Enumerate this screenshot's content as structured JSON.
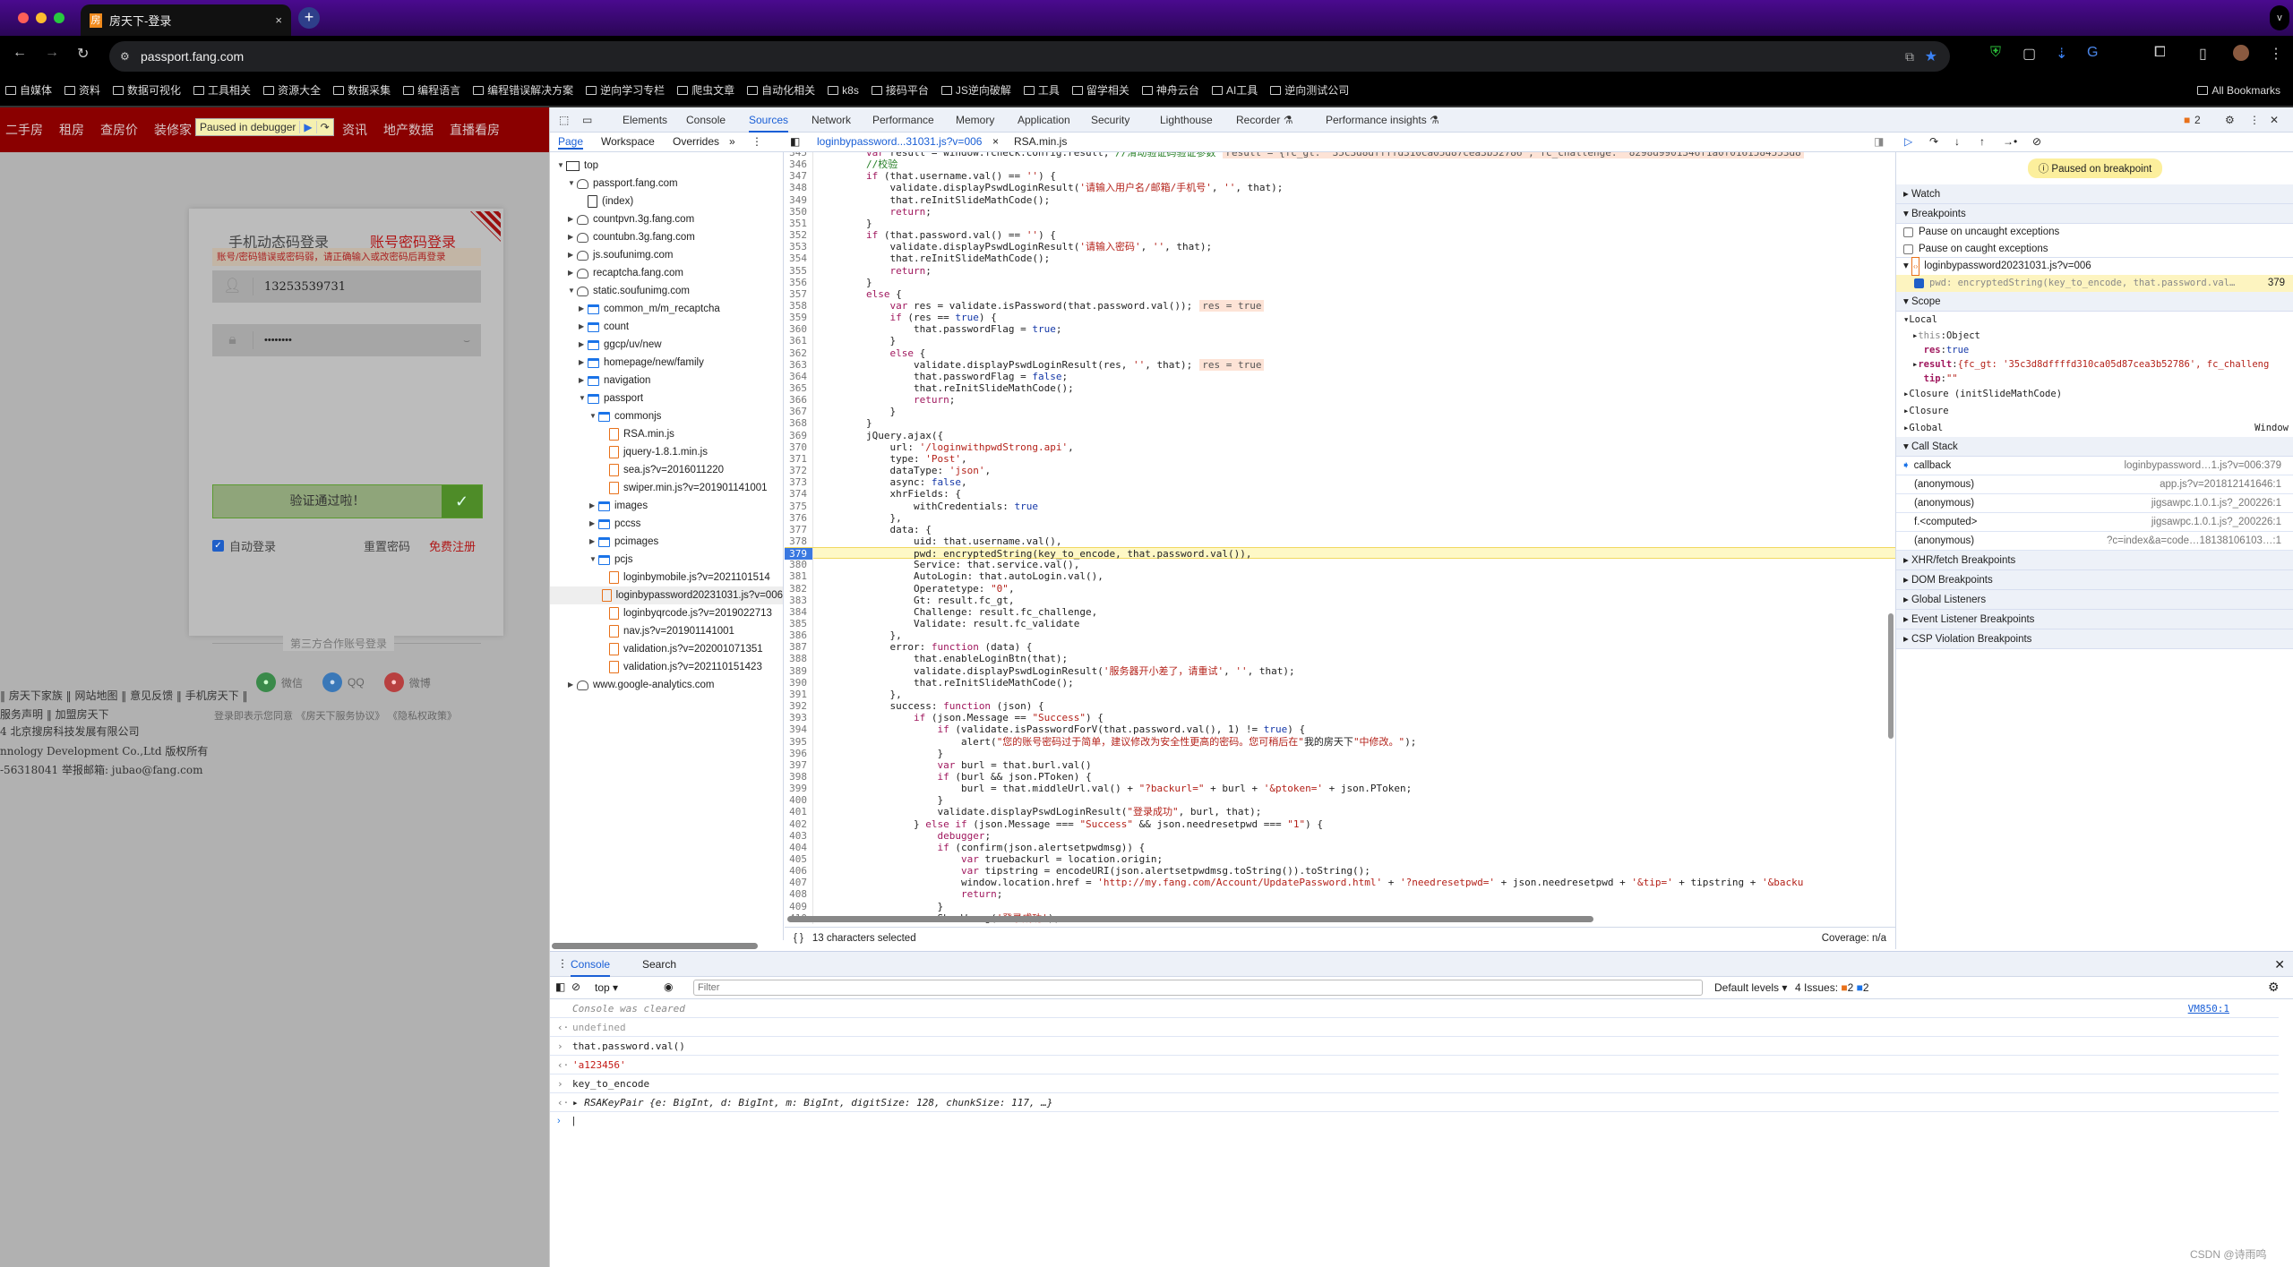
{
  "browser": {
    "tab_title": "房天下-登录",
    "tab_favicon": "房",
    "url": "passport.fang.com",
    "bookmarks": [
      "自媒体",
      "资料",
      "数据可视化",
      "工具相关",
      "资源大全",
      "数据采集",
      "编程语言",
      "编程错误解决方案",
      "逆向学习专栏",
      "爬虫文章",
      "自动化相关",
      "k8s",
      "接码平台",
      "JS逆向破解",
      "工具",
      "留学相关",
      "神舟云台",
      "AI工具",
      "逆向测试公司"
    ],
    "all_bookmarks": "All Bookmarks"
  },
  "page": {
    "nav": [
      "二手房",
      "租房",
      "查房价",
      "装修家",
      "资讯",
      "地产数据",
      "直播看房"
    ],
    "paused_overlay": "Paused in debugger",
    "login": {
      "tab_mobile": "手机动态码登录",
      "tab_password": "账号密码登录",
      "error": "账号/密码错误或密码弱，请正确输入或改密码后再登录",
      "username": "13253539731",
      "password_mask": "••••••••",
      "slider_text": "验证通过啦！",
      "auto_login": "自动登录",
      "reset_password": "重置密码",
      "register": "免费注册",
      "third_party": "第三方合作账号登录",
      "social": [
        "微信",
        "QQ",
        "微博"
      ],
      "agreement": "登录即表示您同意 《房天下服务协议》 《隐私权政策》"
    },
    "footer": [
      "‖  房天下家族  ‖  网站地图  ‖  意见反馈  ‖  手机房天下  ‖",
      "服务声明  ‖  加盟房天下",
      "4 北京搜房科技发展有限公司",
      "nnology Development Co.,Ltd 版权所有",
      "-56318041 举报邮箱: jubao@fang.com"
    ]
  },
  "devtools": {
    "tabs": [
      "Elements",
      "Console",
      "Sources",
      "Network",
      "Performance",
      "Memory",
      "Application",
      "Security",
      "Lighthouse",
      "Recorder ⚗",
      "Performance insights ⚗"
    ],
    "active_tab": "Sources",
    "issues_badge": "2",
    "nav_tabs": [
      "Page",
      "Workspace",
      "Overrides"
    ],
    "open_files": [
      "loginbypassword...31031.js?v=006",
      "RSA.min.js"
    ],
    "tree": [
      {
        "d": 0,
        "t": "frame",
        "open": true,
        "label": "top"
      },
      {
        "d": 1,
        "t": "cloud",
        "open": true,
        "label": "passport.fang.com"
      },
      {
        "d": 2,
        "t": "page",
        "label": "(index)"
      },
      {
        "d": 1,
        "t": "cloud",
        "open": false,
        "label": "countpvn.3g.fang.com"
      },
      {
        "d": 1,
        "t": "cloud",
        "open": false,
        "label": "countubn.3g.fang.com"
      },
      {
        "d": 1,
        "t": "cloud",
        "open": false,
        "label": "js.soufunimg.com"
      },
      {
        "d": 1,
        "t": "cloud",
        "open": false,
        "label": "recaptcha.fang.com"
      },
      {
        "d": 1,
        "t": "cloud",
        "open": true,
        "label": "static.soufunimg.com"
      },
      {
        "d": 2,
        "t": "folder",
        "open": false,
        "label": "common_m/m_recaptcha"
      },
      {
        "d": 2,
        "t": "folder",
        "open": false,
        "label": "count"
      },
      {
        "d": 2,
        "t": "folder",
        "open": false,
        "label": "ggcp/uv/new"
      },
      {
        "d": 2,
        "t": "folder",
        "open": false,
        "label": "homepage/new/family"
      },
      {
        "d": 2,
        "t": "folder",
        "open": false,
        "label": "navigation"
      },
      {
        "d": 2,
        "t": "folder",
        "open": true,
        "label": "passport"
      },
      {
        "d": 3,
        "t": "folder",
        "open": true,
        "label": "commonjs"
      },
      {
        "d": 4,
        "t": "file",
        "label": "RSA.min.js"
      },
      {
        "d": 4,
        "t": "file",
        "label": "jquery-1.8.1.min.js"
      },
      {
        "d": 4,
        "t": "file",
        "label": "sea.js?v=2016011220"
      },
      {
        "d": 4,
        "t": "file",
        "label": "swiper.min.js?v=201901141001"
      },
      {
        "d": 3,
        "t": "folder",
        "open": false,
        "label": "images"
      },
      {
        "d": 3,
        "t": "folder",
        "open": false,
        "label": "pccss"
      },
      {
        "d": 3,
        "t": "folder",
        "open": false,
        "label": "pcimages"
      },
      {
        "d": 3,
        "t": "folder",
        "open": true,
        "label": "pcjs"
      },
      {
        "d": 4,
        "t": "file",
        "label": "loginbymobile.js?v=2021101514"
      },
      {
        "d": 4,
        "t": "file",
        "sel": true,
        "label": "loginbypassword20231031.js?v=006"
      },
      {
        "d": 4,
        "t": "file",
        "label": "loginbyqrcode.js?v=2019022713"
      },
      {
        "d": 4,
        "t": "file",
        "label": "nav.js?v=201901141001"
      },
      {
        "d": 4,
        "t": "file",
        "label": "validation.js?v=202001071351"
      },
      {
        "d": 4,
        "t": "file",
        "label": "validation.js?v=202110151423"
      },
      {
        "d": 1,
        "t": "cloud",
        "open": false,
        "label": "www.google-analytics.com"
      }
    ],
    "code": {
      "first_line": 345,
      "breakpoint_line": 379,
      "lines": [
        "        var result = window.fcheck.config.result; //滑动验证码验证参数",
        "        //校验",
        "        if (that.username.val() == '') {",
        "            validate.displayPswdLoginResult('请输入用户名/邮箱/手机号', '', that);",
        "            that.reInitSlideMathCode();",
        "            return;",
        "        }",
        "        if (that.password.val() == '') {",
        "            validate.displayPswdLoginResult('请输入密码', '', that);",
        "            that.reInitSlideMathCode();",
        "            return;",
        "        }",
        "        else {",
        "            var res = validate.isPassword(that.password.val());",
        "            if (res == true) {",
        "                that.passwordFlag = true;",
        "            }",
        "            else {",
        "                validate.displayPswdLoginResult(res, '', that);",
        "                that.passwordFlag = false;",
        "                that.reInitSlideMathCode();",
        "                return;",
        "            }",
        "        }",
        "        jQuery.ajax({",
        "            url: '/loginwithpwdStrong.api',",
        "            type: 'Post',",
        "            dataType: 'json',",
        "            async: false,",
        "            xhrFields: {",
        "                withCredentials: true",
        "            },",
        "            data: {",
        "                uid: that.username.val(),",
        "                pwd: encryptedString(key_to_encode, that.password.val()),",
        "                Service: that.service.val(),",
        "                AutoLogin: that.autoLogin.val(),",
        "                Operatetype: \"0\",",
        "                Gt: result.fc_gt,",
        "                Challenge: result.fc_challenge,",
        "                Validate: result.fc_validate",
        "            },",
        "            error: function (data) {",
        "                that.enableLoginBtn(that);",
        "                validate.displayPswdLoginResult('服务器开小差了，请重试', '', that);",
        "                that.reInitSlideMathCode();",
        "            },",
        "            success: function (json) {",
        "                if (json.Message == \"Success\") {",
        "                    if (validate.isPasswordForV(that.password.val(), 1) != true) {",
        "                        alert(\"您的账号密码过于简单，建议修改为安全性更高的密码。您可稍后在\"我的房天下\"中修改。\");",
        "                    }",
        "                    var burl = that.burl.val()",
        "                    if (burl && json.PToken) {",
        "                        burl = that.middleUrl.val() + \"?backurl=\" + burl + '&ptoken=' + json.PToken;",
        "                    }",
        "                    validate.displayPswdLoginResult(\"登录成功\", burl, that);",
        "                } else if (json.Message === \"Success\" && json.needresetpwd === \"1\") {",
        "                    debugger;",
        "                    if (confirm(json.alertsetpwdmsg)) {",
        "                        var truebackurl = location.origin;",
        "                        var tipstring = encodeURI(json.alertsetpwdmsg.toString()).toString();",
        "                        window.location.href = 'http://my.fang.com/Account/UpdatePassword.html' + '?needresetpwd=' + json.needresetpwd + '&tip=' + tipstring + '&backu",
        "                        return;",
        "                    }",
        "                    ShowWrong('登录成功');"
      ],
      "inline_values": {
        "345": "result = {fc_gt: '35c3d8dffffd310ca05d87cea3b52786', fc_challenge: '8298d9901346f1a0f0161584553d8",
        "358": "res = true",
        "363": "res = true"
      }
    },
    "status": {
      "selection": "13 characters selected",
      "coverage": "Coverage: n/a"
    },
    "sidebar": {
      "paused": "Paused on breakpoint",
      "watch": "Watch",
      "breakpoints": "Breakpoints",
      "pause_uncaught": "Pause on uncaught exceptions",
      "pause_caught": "Pause on caught exceptions",
      "bp_file": "loginbypassword20231031.js?v=006",
      "bp_code": "pwd: encryptedString(key_to_encode, that.password.val…",
      "bp_line": "379",
      "scope": "Scope",
      "local": "Local",
      "scope_vars": [
        {
          "k": "this",
          "v": "Object",
          "arrow": true
        },
        {
          "k": "res",
          "v": "true"
        },
        {
          "k": "result",
          "v": "{fc_gt: '35c3d8dffffd310ca05d87cea3b52786', fc_challeng",
          "arrow": true
        },
        {
          "k": "tip",
          "v": "\"\""
        }
      ],
      "closures": [
        "Closure (initSlideMathCode)",
        "Closure"
      ],
      "global": "Global",
      "global_val": "Window",
      "callstack": "Call Stack",
      "frames": [
        {
          "fn": "callback",
          "loc": "loginbypassword…1.js?v=006:379",
          "current": true
        },
        {
          "fn": "(anonymous)",
          "loc": "app.js?v=201812141646:1"
        },
        {
          "fn": "(anonymous)",
          "loc": "jigsawpc.1.0.1.js?_200226:1"
        },
        {
          "fn": "f.<computed>",
          "loc": "jigsawpc.1.0.1.js?_200226:1"
        },
        {
          "fn": "(anonymous)",
          "loc": "?c=index&a=code…18138106103…:1"
        }
      ],
      "more": [
        "XHR/fetch Breakpoints",
        "DOM Breakpoints",
        "Global Listeners",
        "Event Listener Breakpoints",
        "CSP Violation Breakpoints"
      ]
    },
    "drawer": {
      "tabs": [
        "Console",
        "Search"
      ],
      "context": "top",
      "filter_placeholder": "Filter",
      "levels": "Default levels",
      "issues_label": "4 Issues:",
      "issues_warn": "2",
      "issues_info": "2",
      "messages": [
        {
          "p": "",
          "text": "Console was cleared",
          "cls": "cleared",
          "src": "VM850:1"
        },
        {
          "p": "‹·",
          "text": "undefined",
          "cls": "undef"
        },
        {
          "p": "›",
          "text": "that.password.val()",
          "cls": "in"
        },
        {
          "p": "‹·",
          "text": "'a123456'",
          "cls": "strv"
        },
        {
          "p": "›",
          "text": "key_to_encode",
          "cls": "in"
        },
        {
          "p": "‹·",
          "text": "▸ RSAKeyPair {e: BigInt, d: BigInt, m: BigInt, digitSize: 128, chunkSize: 117, …}",
          "cls": "obj"
        }
      ]
    }
  },
  "watermark": "CSDN @诗雨鸣"
}
